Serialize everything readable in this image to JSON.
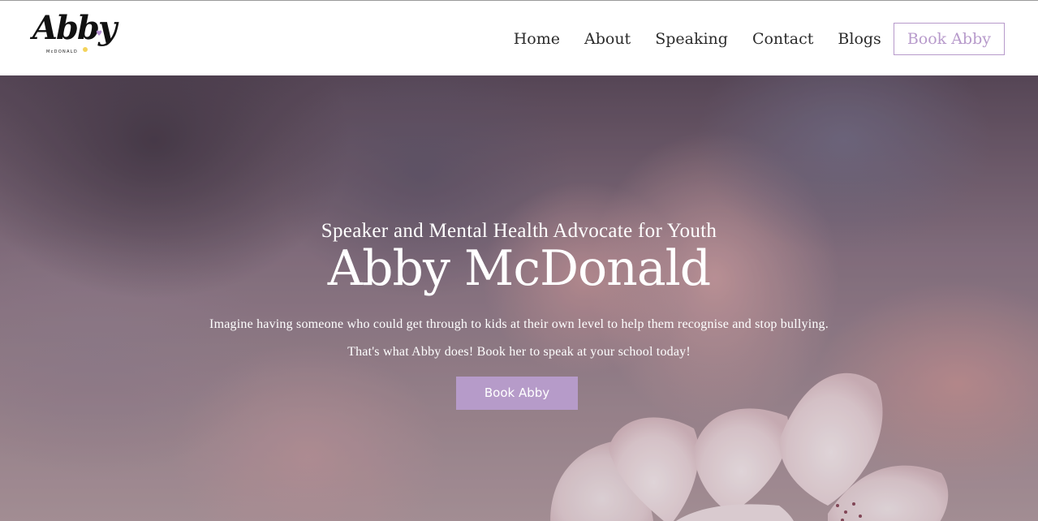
{
  "brand": {
    "logo_word": "Abby",
    "logo_sub": "McDONALD",
    "logo_heart": "♥",
    "accent_yellow": "#f3d35b",
    "accent_purple": "#b48fd0"
  },
  "nav": {
    "items": [
      {
        "label": "Home"
      },
      {
        "label": "About"
      },
      {
        "label": "Speaking"
      },
      {
        "label": "Contact"
      },
      {
        "label": "Blogs"
      }
    ],
    "cta_label": "Book Abby",
    "cta_color": "#b79acb"
  },
  "hero": {
    "kicker": "Speaker and Mental Health Advocate for Youth",
    "title": "Abby McDonald",
    "line1": "Imagine having someone who could get through to kids at their own level to help them recognise and stop bullying.",
    "line2": "That's what Abby does! Book her to speak at your school today!",
    "button_label": "Book Abby",
    "button_color": "#b69bc9",
    "background_image": "blurred pink cherry blossom"
  }
}
